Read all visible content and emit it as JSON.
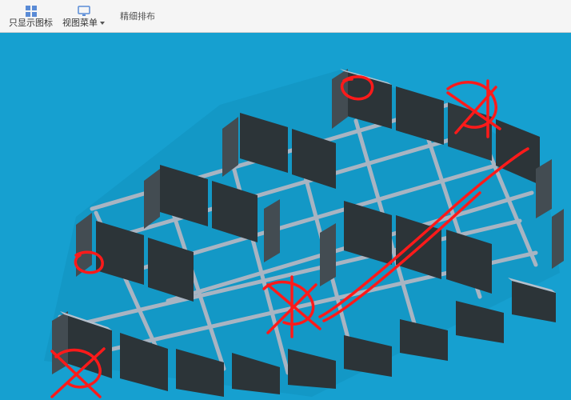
{
  "toolbar": {
    "show_icons_only": "只显示图标",
    "view_menu": "视图菜单",
    "fine_layout": "精细排布"
  },
  "viewport": {
    "background_color": "#16a0d0",
    "wall_dark": "#333a3a",
    "wall_light": "#9aa6b2",
    "beam_color": "#8a96a6",
    "annotation_color": "#ff1a1a"
  }
}
